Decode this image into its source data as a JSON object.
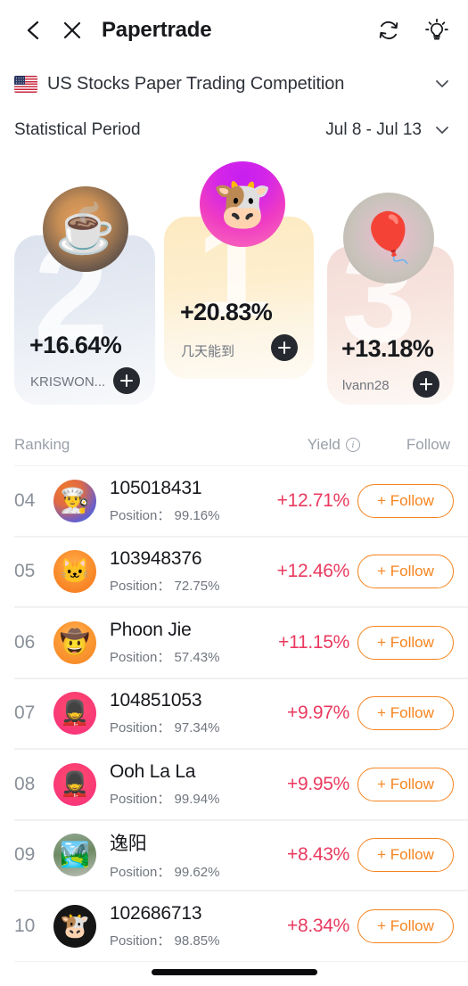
{
  "header": {
    "title": "Papertrade",
    "back_icon": "chevron-left-icon",
    "close_icon": "close-icon",
    "refresh_icon": "refresh-icon",
    "bulb_icon": "lightbulb-icon"
  },
  "competition": {
    "flag_icon": "us-flag-icon",
    "name": "US Stocks Paper Trading Competition",
    "chevron_icon": "chevron-down-icon"
  },
  "period": {
    "label": "Statistical Period",
    "value": "Jul 8 - Jul 13",
    "chevron_icon": "chevron-down-icon"
  },
  "podium": [
    {
      "place": "2",
      "yield": "+16.64%",
      "username": "KRISWON...",
      "avatar_emoji": "☕",
      "follow_icon": "plus-icon"
    },
    {
      "place": "1",
      "yield": "+20.83%",
      "username": "几天能到",
      "avatar_emoji": "🐮",
      "follow_icon": "plus-icon"
    },
    {
      "place": "3",
      "yield": "+13.18%",
      "username": "lvann28",
      "avatar_emoji": "🎈",
      "follow_icon": "plus-icon"
    }
  ],
  "list_header": {
    "ranking": "Ranking",
    "yield": "Yield",
    "info_icon": "info-icon",
    "follow": "Follow"
  },
  "colors": {
    "yield_positive": "#ea3a5f",
    "follow_accent": "#f5841f",
    "muted_text": "#70757e",
    "rank_text": "#8a9099"
  },
  "position_label": "Position：",
  "follow_label": "+ Follow",
  "rows": [
    {
      "rank": "04",
      "name": "105018431",
      "position": "Position：  99.16%",
      "yield": "+12.71%",
      "follow": "+ Follow",
      "avatar_emoji": "👨‍🍳"
    },
    {
      "rank": "05",
      "name": "103948376",
      "position": "Position：  72.75%",
      "yield": "+12.46%",
      "follow": "+ Follow",
      "avatar_emoji": "🐱"
    },
    {
      "rank": "06",
      "name": "Phoon Jie",
      "position": "Position：  57.43%",
      "yield": "+11.15%",
      "follow": "+ Follow",
      "avatar_emoji": "🤠"
    },
    {
      "rank": "07",
      "name": "104851053",
      "position": "Position：  97.34%",
      "yield": "+9.97%",
      "follow": "+ Follow",
      "avatar_emoji": "💂"
    },
    {
      "rank": "08",
      "name": "Ooh La La",
      "position": "Position：  99.94%",
      "yield": "+9.95%",
      "follow": "+ Follow",
      "avatar_emoji": "💂"
    },
    {
      "rank": "09",
      "name": "逸阳",
      "position": "Position：  99.62%",
      "yield": "+8.43%",
      "follow": "+ Follow",
      "avatar_emoji": "🏞️"
    },
    {
      "rank": "10",
      "name": "102686713",
      "position": "Position：  98.85%",
      "yield": "+8.34%",
      "follow": "+ Follow",
      "avatar_emoji": "🐮"
    }
  ]
}
